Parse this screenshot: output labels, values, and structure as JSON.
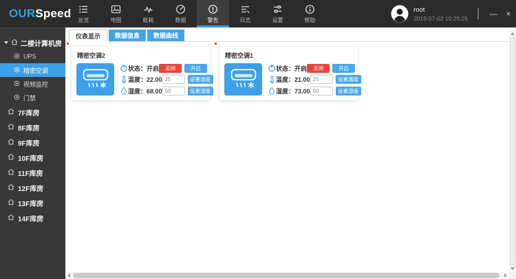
{
  "window": {
    "logo_primary": "OUR",
    "logo_secondary": "Speed",
    "minimize_glyph": "—",
    "close_glyph": "×"
  },
  "topbar": {
    "nav": [
      {
        "label": "总览",
        "icon": "list-icon"
      },
      {
        "label": "地图",
        "icon": "map-icon"
      },
      {
        "label": "能耗",
        "icon": "energy-icon"
      },
      {
        "label": "数据",
        "icon": "gauge-icon"
      },
      {
        "label": "警告",
        "icon": "alert-icon",
        "active": true
      },
      {
        "label": "日志",
        "icon": "log-icon"
      },
      {
        "label": "设置",
        "icon": "settings-icon"
      },
      {
        "label": "帮助",
        "icon": "help-icon"
      }
    ],
    "user": {
      "name": "root",
      "datetime": "2019-07-02 10:25:25"
    }
  },
  "sidebar": {
    "room": {
      "label": "二楼计算机房"
    },
    "devices": [
      {
        "label": "UPS",
        "selected": false
      },
      {
        "label": "精密空调",
        "selected": true
      },
      {
        "label": "视频监控",
        "selected": false
      },
      {
        "label": "门禁",
        "selected": false
      }
    ],
    "floors": [
      {
        "label": "7F库房"
      },
      {
        "label": "8F库房"
      },
      {
        "label": "9F库房"
      },
      {
        "label": "10F库房"
      },
      {
        "label": "11F库房"
      },
      {
        "label": "12F库房"
      },
      {
        "label": "13F库房"
      },
      {
        "label": "14F库房"
      }
    ]
  },
  "tabs": [
    {
      "label": "仪表显示",
      "active": true
    },
    {
      "label": "数据信息",
      "active": false
    },
    {
      "label": "数据曲线",
      "active": false
    }
  ],
  "cards": [
    {
      "title": "精密空调2",
      "status_label": "状态：",
      "status_value": "开启",
      "temp_label": "温度：",
      "temp_value": "22.00",
      "temp_setpoint": "25",
      "humidity_label": "湿度：",
      "humidity_value": "68.00",
      "humidity_setpoint": "50",
      "close_button": "关闭",
      "open_button": "开启",
      "set_temp_button": "设置温度",
      "set_humidity_button": "设置湿度"
    },
    {
      "title": "精密空调1",
      "status_label": "状态：",
      "status_value": "开启",
      "temp_label": "温度：",
      "temp_value": "21.00",
      "temp_setpoint": "25",
      "humidity_label": "湿度：",
      "humidity_value": "73.00",
      "humidity_setpoint": "50",
      "close_button": "关闭",
      "open_button": "开启",
      "set_temp_button": "设置温度",
      "set_humidity_button": "设置湿度"
    }
  ],
  "colors": {
    "accent_blue": "#3da0e8",
    "danger_red": "#e8463d",
    "topbar_bg": "#2b2b2b",
    "sidebar_bg": "#383838"
  }
}
